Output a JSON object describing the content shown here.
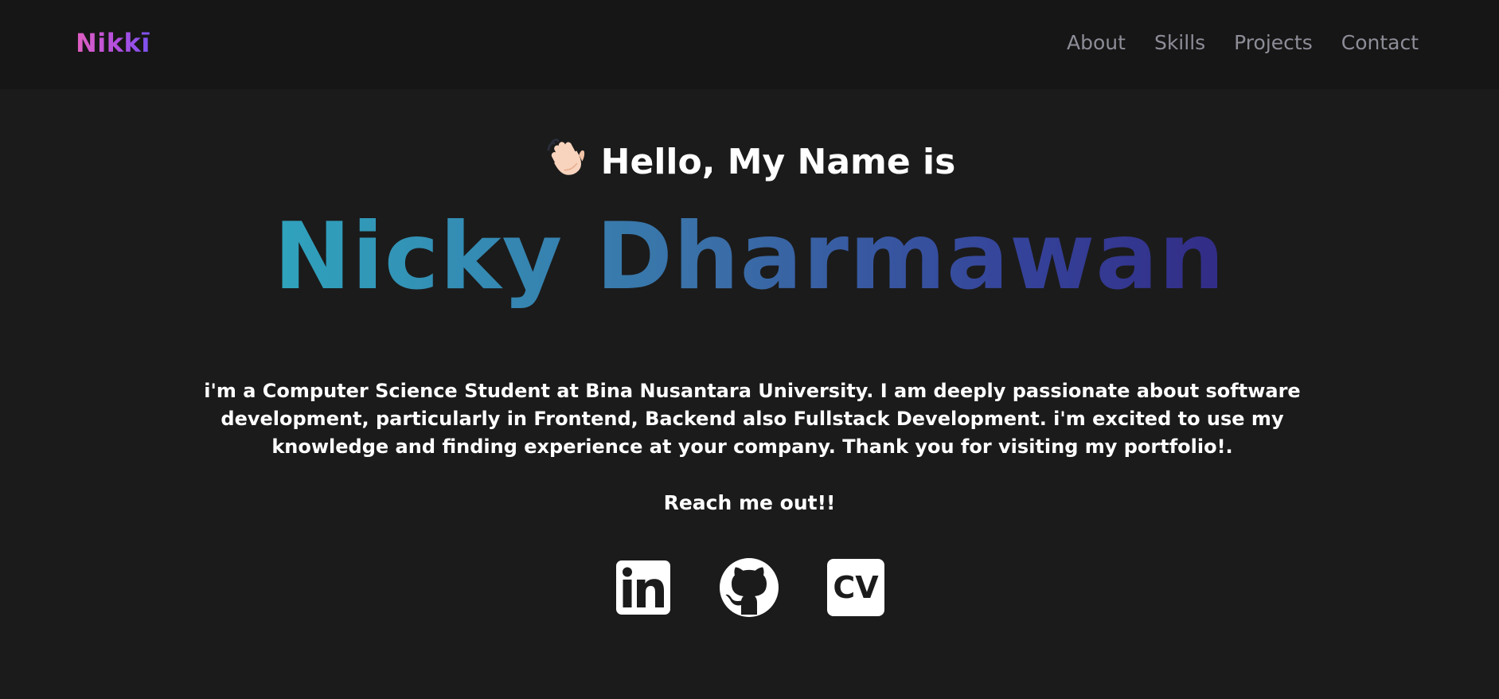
{
  "navbar": {
    "brand": "Nikkī",
    "links": [
      "About",
      "Skills",
      "Projects",
      "Contact"
    ]
  },
  "hero": {
    "wave_icon": "waving-hand-icon",
    "greeting": "Hello, My Name is",
    "name": "Nicky Dharmawan",
    "bio": "i'm a Computer Science Student at Bina Nusantara University. I am deeply passionate about software development, particularly in Frontend, Backend also Fullstack Development. i'm excited to use my knowledge and finding experience at your company. Thank you for visiting my portfolio!.",
    "reach": "Reach me out!!"
  },
  "socials": {
    "linkedin_icon": "linkedin-icon",
    "github_icon": "github-icon",
    "cv_label": "CV"
  },
  "colors": {
    "background": "#1b1b1b",
    "navbar_background": "#161616",
    "nav_link": "#8d8d98",
    "brand_gradient": [
      "#e05fc0",
      "#7a52f0"
    ],
    "name_gradient": [
      "#2fa3bd",
      "#322c86"
    ]
  }
}
